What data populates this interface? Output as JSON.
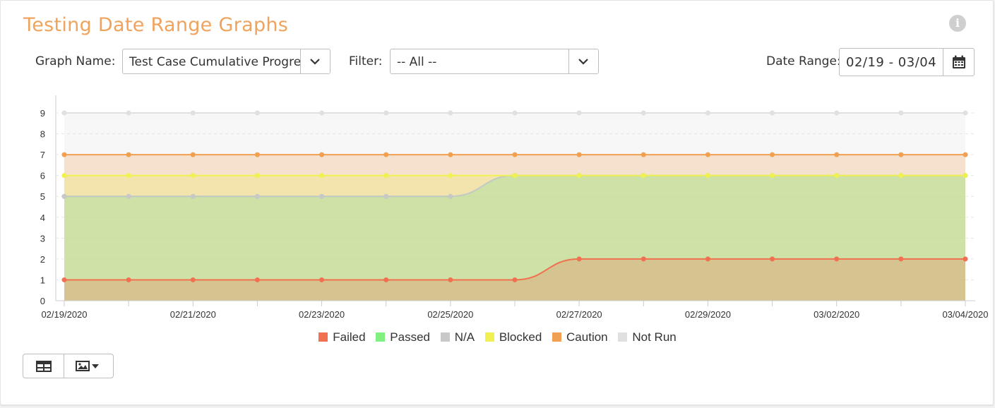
{
  "header": {
    "title": "Testing Date Range Graphs",
    "info_icon": "info-circle-icon"
  },
  "controls": {
    "graph_name_label": "Graph Name:",
    "graph_name_value": "Test Case Cumulative Progress",
    "filter_label": "Filter:",
    "filter_value": "-- All --",
    "date_range_label": "Date Range:",
    "date_range_value": "02/19 - 03/04"
  },
  "toolbar": {
    "table_icon": "table-icon",
    "image_icon": "image-dropdown-icon"
  },
  "chart_data": {
    "type": "area",
    "stacked": true,
    "x": [
      "02/19/2020",
      "02/20/2020",
      "02/21/2020",
      "02/22/2020",
      "02/23/2020",
      "02/24/2020",
      "02/25/2020",
      "02/26/2020",
      "02/27/2020",
      "02/28/2020",
      "02/29/2020",
      "03/01/2020",
      "03/02/2020",
      "03/03/2020",
      "03/04/2020"
    ],
    "x_tick_labels": [
      "02/19/2020",
      "02/21/2020",
      "02/23/2020",
      "02/25/2020",
      "02/27/2020",
      "02/29/2020",
      "03/02/2020",
      "03/04/2020"
    ],
    "ylim": [
      0,
      9
    ],
    "y_ticks": [
      0,
      1,
      2,
      3,
      4,
      5,
      6,
      7,
      8,
      9
    ],
    "grid": true,
    "legend_position": "bottom",
    "series": [
      {
        "name": "Failed",
        "color": "#f07050",
        "values": [
          1,
          1,
          1,
          1,
          1,
          1,
          1,
          1,
          2,
          2,
          2,
          2,
          2,
          2,
          2
        ]
      },
      {
        "name": "Passed",
        "color": "#80f080",
        "values": [
          4,
          4,
          4,
          4,
          4,
          4,
          4,
          5,
          4,
          4,
          4,
          4,
          4,
          4,
          4
        ]
      },
      {
        "name": "N/A",
        "color": "#c8c8c8",
        "values": [
          0,
          0,
          0,
          0,
          0,
          0,
          0,
          0,
          0,
          0,
          0,
          0,
          0,
          0,
          0
        ]
      },
      {
        "name": "Blocked",
        "color": "#f0f050",
        "values": [
          1,
          1,
          1,
          1,
          1,
          1,
          1,
          0,
          0,
          0,
          0,
          0,
          0,
          0,
          0
        ]
      },
      {
        "name": "Caution",
        "color": "#f0a050",
        "values": [
          1,
          1,
          1,
          1,
          1,
          1,
          1,
          1,
          1,
          1,
          1,
          1,
          1,
          1,
          1
        ]
      },
      {
        "name": "Not Run",
        "color": "#e0e0e0",
        "values": [
          2,
          2,
          2,
          2,
          2,
          2,
          2,
          2,
          2,
          2,
          2,
          2,
          2,
          2,
          2
        ]
      }
    ]
  }
}
